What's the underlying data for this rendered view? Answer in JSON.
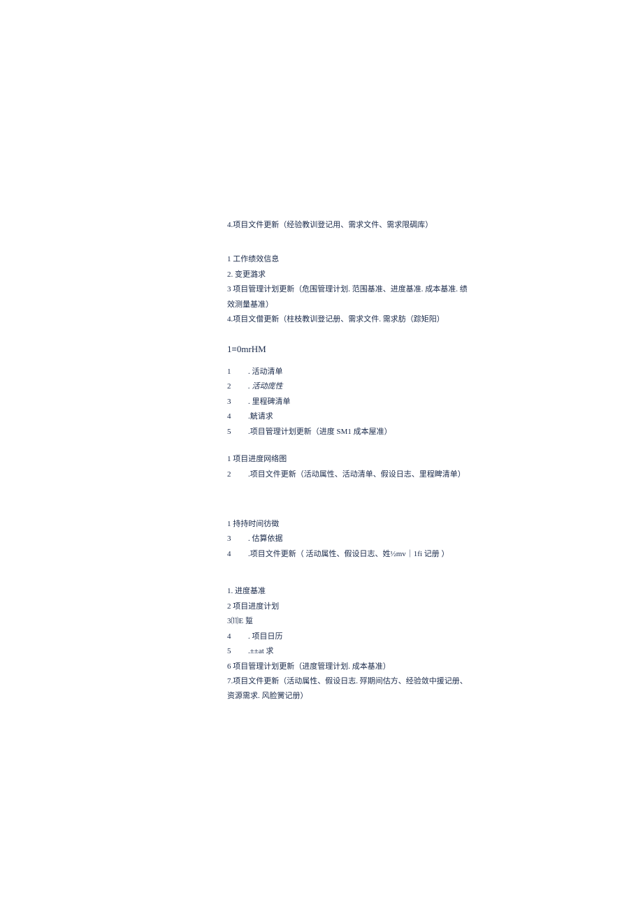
{
  "block1": {
    "l1": "4.项目文件更新（经验教训登记用、需求文件、需求限碉库）"
  },
  "block2": {
    "l1": "1 工作绩效信息",
    "l2": "2. 变更潞求",
    "l3": "3 项目管理计划更新（危围管理计划. 范围基准、进度基准. 成本基准. 绩",
    "l4": "效测量基准）",
    "l5": "4.项目文僧更新（柱枝教训登记册、需求文件. 需求肪（踪矩阳）"
  },
  "heading1": "1≡0mrHM",
  "block3": {
    "l1_n": "1",
    "l1_t": ". 活动清单",
    "l2_n": "2",
    "l2_t": ". 活动庞性",
    "l3_n": "3",
    "l3_t": ". 里程碑清单",
    "l4_n": "4",
    "l4_t": ".觥请求",
    "l5_n": "5",
    "l5_t": ".项目管理计划更新（进度 SM1 成本屋准）"
  },
  "block4": {
    "l1": "1 项目进度网络图",
    "l2_n": "2",
    "l2_t": ".项目文件更新（活动属性、活动清单、假设日志、里程睥清单）"
  },
  "block5": {
    "l1": "1 持持时间彷徵",
    "l2_n": "3",
    "l2_t": ". 估算依据",
    "l3_n": "4",
    "l3_t": ".项目文件更新（ 活动属性、假设日志、姓½mv｜1fi 记册 ）"
  },
  "block6": {
    "l1": "1. 进度基准",
    "l2": "2 项目进度计划",
    "l3": "3⑾E 踅",
    "l4_n": "4",
    "l4_t": ". 项目日历",
    "l5_n": "5",
    "l5_t": ".±±at 求",
    "l6": "6 项目管理计划更新（进度管理计划. 成本基准）",
    "l7": "7.项目文件更新（活动属性、假设日志. 殍期间估方、经验敛中援记册、",
    "l8": "资源需求. 风脸黉记册）"
  }
}
